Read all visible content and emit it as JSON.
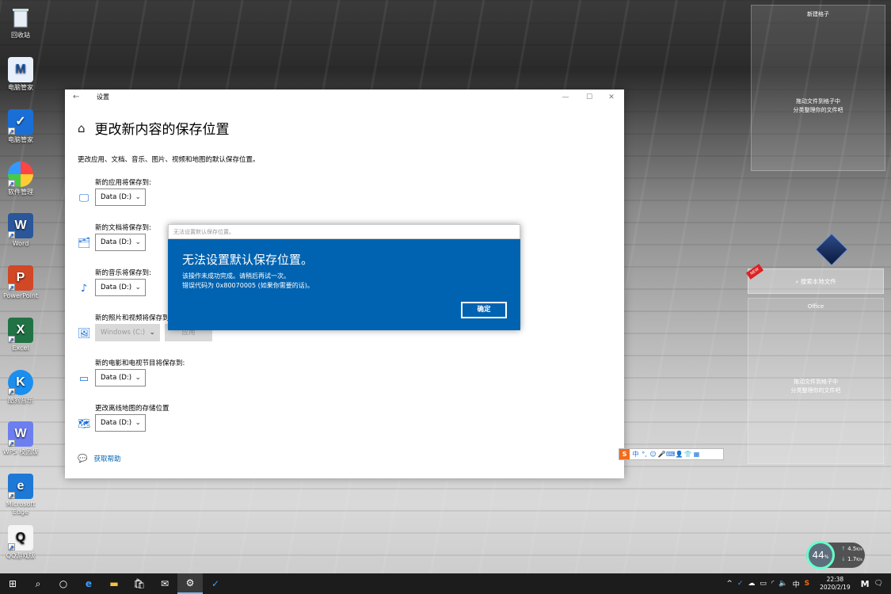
{
  "desktop": {
    "icons": [
      {
        "label": "回收站",
        "icon": "recycle-bin-icon"
      },
      {
        "label": "电脑管家",
        "icon": "pc-manager-icon"
      },
      {
        "label": "电脑管家",
        "icon": "tencent-shield-icon"
      },
      {
        "label": "软件管理",
        "icon": "app-manager-icon"
      },
      {
        "label": "Word",
        "icon": "word-icon"
      },
      {
        "label": "PowerPoint",
        "icon": "powerpoint-icon"
      },
      {
        "label": "Excel",
        "icon": "excel-icon"
      },
      {
        "label": "酷狗音乐",
        "icon": "kugou-icon"
      },
      {
        "label": "WPS 校园版",
        "icon": "wps-icon"
      },
      {
        "label": "Microsoft Edge",
        "icon": "edge-icon"
      },
      {
        "label": "QQ游戏版",
        "icon": "qq-icon"
      }
    ]
  },
  "settings_window": {
    "title": "设置",
    "page_title": "更改新内容的保存位置",
    "description": "更改应用、文档、音乐、图片、视频和地图的默认保存位置。",
    "sections": [
      {
        "label": "新的应用将保存到:",
        "value": "Data (D:)",
        "icon": "monitor-icon"
      },
      {
        "label": "新的文档将保存到:",
        "value": "Data (D:)",
        "icon": "documents-folder-icon"
      },
      {
        "label": "新的音乐将保存到:",
        "value": "Data (D:)",
        "icon": "music-note-icon"
      },
      {
        "label": "新的照片和视频将保存到:",
        "value": "Windows (C:)",
        "apply": "应用",
        "icon": "photo-icon"
      },
      {
        "label": "新的电影和电视节目将保存到:",
        "value": "Data (D:)",
        "icon": "video-camera-icon"
      },
      {
        "label": "更改离线地图的存储位置",
        "value": "Data (D:)",
        "icon": "map-icon"
      }
    ],
    "help_link": "获取帮助"
  },
  "dialog": {
    "titlebar": "无法设置默认保存位置。",
    "heading": "无法设置默认保存位置。",
    "line1": "该操作未成功完成。请稍后再试一次。",
    "line2": "错误代码为 0x80070005 (如果你需要的话)。",
    "ok": "确定"
  },
  "fences": {
    "top_title": "新建格子",
    "top_hint1": "拖动文件到格子中",
    "top_hint2": "分类整理你的文件吧",
    "search": "搜索本地文件",
    "office_title": "Office",
    "office_hint1": "拖动文件到格子中",
    "office_hint2": "分类整理你的文件吧"
  },
  "speed_widget": {
    "percent": "44",
    "unit": "%",
    "up": "4.5",
    "down": "1.7",
    "rate_unit": "K/s"
  },
  "ime": {
    "label": "中"
  },
  "taskbar": {
    "time": "22:38",
    "date": "2020/2/19",
    "tray_lang": "中"
  }
}
